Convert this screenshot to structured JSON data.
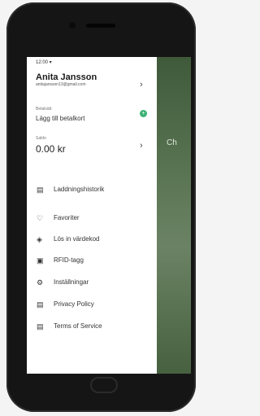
{
  "status_bar": {
    "time": "12:00 ▾"
  },
  "profile": {
    "name": "Anita Jansson",
    "email": "anitajansson13@gmail.com"
  },
  "payment": {
    "label": "Betalsätt",
    "value": "Lägg till betalkort",
    "badge": "+"
  },
  "balance": {
    "label": "Saldo",
    "value": "0.00 kr"
  },
  "menu": [
    {
      "icon": "receipt-icon",
      "symbol": "▤",
      "label": "Laddningshistorik"
    },
    {
      "icon": "heart-icon",
      "symbol": "♡",
      "label": "Favoriter"
    },
    {
      "icon": "tag-icon",
      "symbol": "◈",
      "label": "Lös in värdekod"
    },
    {
      "icon": "rfid-icon",
      "symbol": "▣",
      "label": "RFID-tagg"
    },
    {
      "icon": "gear-icon",
      "symbol": "⚙",
      "label": "Inställningar"
    },
    {
      "icon": "document-icon",
      "symbol": "▤",
      "label": "Privacy Policy"
    },
    {
      "icon": "document-icon",
      "symbol": "▤",
      "label": "Terms of Service"
    }
  ],
  "background": {
    "text": "Ch"
  }
}
